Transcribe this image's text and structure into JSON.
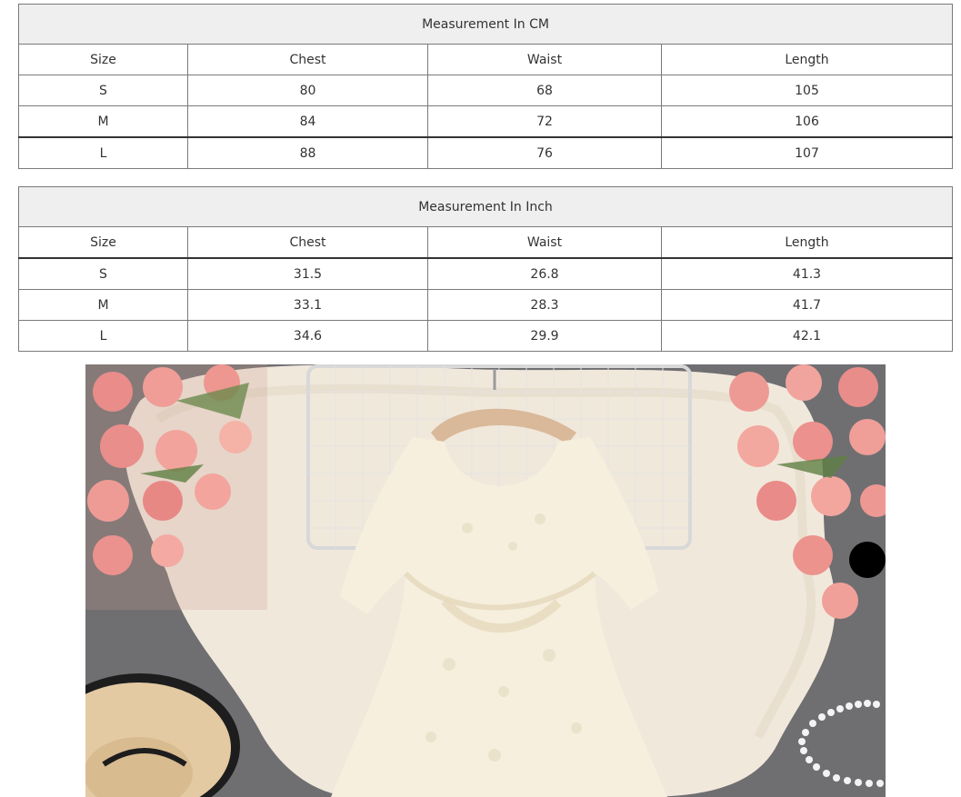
{
  "tables": [
    {
      "title": "Measurement In CM",
      "headers": [
        "Size",
        "Chest",
        "Waist",
        "Length"
      ],
      "rows": [
        [
          "S",
          "80",
          "68",
          "105"
        ],
        [
          "M",
          "84",
          "72",
          "106"
        ],
        [
          "L",
          "88",
          "76",
          "107"
        ]
      ]
    },
    {
      "title": "Measurement In Inch",
      "headers": [
        "Size",
        "Chest",
        "Waist",
        "Length"
      ],
      "rows": [
        [
          "S",
          "31.5",
          "26.8",
          "41.3"
        ],
        [
          "M",
          "33.1",
          "28.3",
          "41.7"
        ],
        [
          "L",
          "34.6",
          "29.9",
          "42.1"
        ]
      ]
    }
  ],
  "colors": {
    "title_bg": "#efefef",
    "border": "#7a7a7a",
    "text": "#333333"
  }
}
